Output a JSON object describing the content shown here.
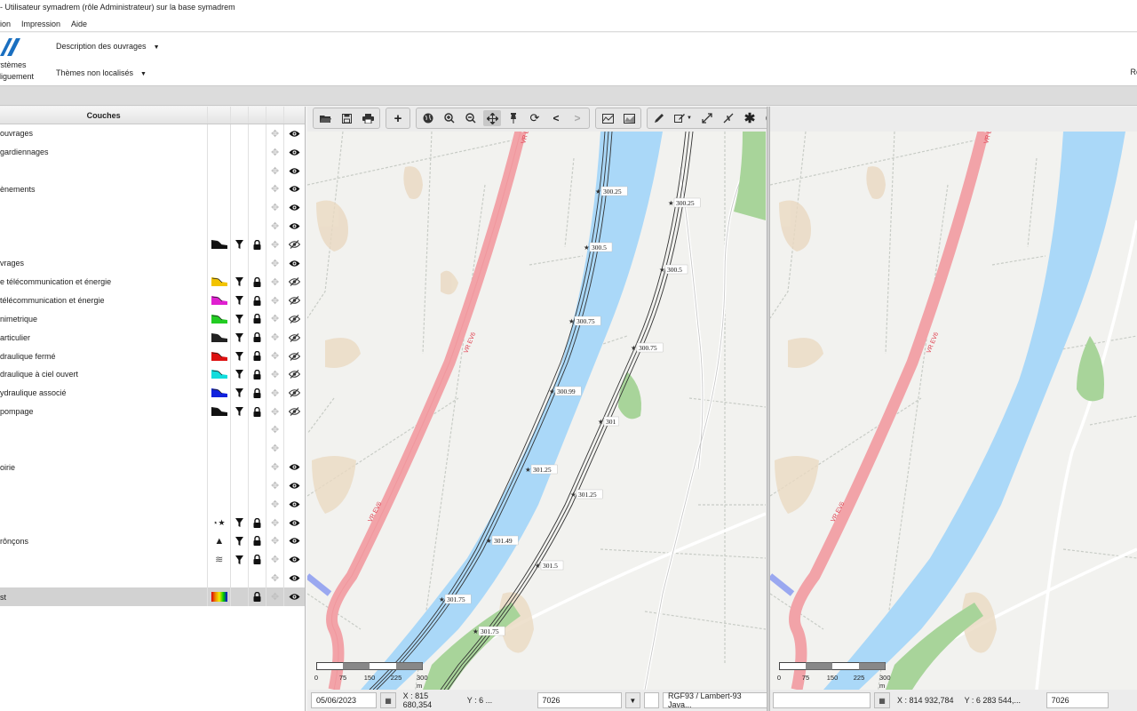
{
  "window": {
    "title": "- Utilisateur symadrem (rôle Administrateur) sur la base symadrem"
  },
  "menu": [
    "ion",
    "Impression",
    "Aide"
  ],
  "ribbon": {
    "brand_line1": "ystèmes",
    "brand_line2": "diguement",
    "description_label": "Description des ouvrages",
    "themes_label": "Thèmes non localisés",
    "right_label": "Re"
  },
  "layers": {
    "header": "Couches",
    "rows": [
      {
        "label": "ouvrages",
        "swatch": "",
        "filter": false,
        "lock": false,
        "eye": "open"
      },
      {
        "label": "gardiennages",
        "swatch": "",
        "filter": false,
        "lock": false,
        "eye": "open"
      },
      {
        "label": "",
        "swatch": "",
        "filter": false,
        "lock": false,
        "eye": "open"
      },
      {
        "label": "ènements",
        "swatch": "",
        "filter": false,
        "lock": false,
        "eye": "open"
      },
      {
        "label": "",
        "swatch": "",
        "filter": false,
        "lock": false,
        "eye": "open"
      },
      {
        "label": "",
        "swatch": "",
        "filter": false,
        "lock": false,
        "eye": "open"
      },
      {
        "label": "",
        "swatch": "#111111",
        "filter": true,
        "lock": true,
        "eye": "hidden"
      },
      {
        "label": "vrages",
        "swatch": "",
        "filter": false,
        "lock": false,
        "eye": "open"
      },
      {
        "label": "e télécommunication et énergie",
        "swatch": "#f2c300",
        "filter": true,
        "lock": true,
        "eye": "hidden"
      },
      {
        "label": "télécommunication et énergie",
        "swatch": "#e020d0",
        "filter": true,
        "lock": true,
        "eye": "hidden"
      },
      {
        "label": "nimetrique",
        "swatch": "#22cc22",
        "filter": true,
        "lock": true,
        "eye": "hidden"
      },
      {
        "label": "articulier",
        "swatch": "#222222",
        "filter": true,
        "lock": true,
        "eye": "hidden"
      },
      {
        "label": "draulique fermé",
        "swatch": "#dd1111",
        "filter": true,
        "lock": true,
        "eye": "hidden"
      },
      {
        "label": "draulique à ciel ouvert",
        "swatch": "#11dddd",
        "filter": true,
        "lock": true,
        "eye": "hidden"
      },
      {
        "label": "ydraulique associé",
        "swatch": "#1122dd",
        "filter": true,
        "lock": true,
        "eye": "hidden"
      },
      {
        "label": "pompage",
        "swatch": "#111111",
        "filter": true,
        "lock": true,
        "eye": "hidden"
      },
      {
        "label": "",
        "swatch": "",
        "filter": false,
        "lock": false,
        "eye": "none"
      },
      {
        "label": "",
        "swatch": "",
        "filter": false,
        "lock": false,
        "eye": "none"
      },
      {
        "label": "oirie",
        "swatch": "",
        "filter": false,
        "lock": false,
        "eye": "open"
      },
      {
        "label": "",
        "swatch": "",
        "filter": false,
        "lock": false,
        "eye": "open"
      },
      {
        "label": "",
        "swatch": "",
        "filter": false,
        "lock": false,
        "eye": "open"
      },
      {
        "label": "",
        "swatch": "star",
        "filter": true,
        "lock": true,
        "eye": "open"
      },
      {
        "label": "rônçons",
        "swatch": "triangle",
        "filter": true,
        "lock": true,
        "eye": "open"
      },
      {
        "label": "",
        "swatch": "waves",
        "filter": true,
        "lock": true,
        "eye": "open"
      },
      {
        "label": "",
        "swatch": "",
        "filter": false,
        "lock": false,
        "eye": "open"
      },
      {
        "label": "st",
        "swatch": "gradient",
        "filter": false,
        "lock": true,
        "eye": "open",
        "selected": true
      }
    ]
  },
  "toolbar_icons": {
    "file": [
      "open-folder-icon",
      "save-icon",
      "print-icon"
    ],
    "add": [
      "plus-icon"
    ],
    "nav": [
      "globe-icon",
      "zoom-in-icon",
      "zoom-out-icon",
      "pan-icon",
      "pin-icon",
      "refresh-icon",
      "back-icon",
      "forward-icon"
    ],
    "profile": [
      "profile-line-icon",
      "profile-area-icon"
    ],
    "edit": [
      "pencil-icon",
      "edit-menu-icon",
      "expand-icon",
      "shrink-icon",
      "asterisk-icon",
      "target-icon",
      "copy-icon",
      "export-icon",
      "info-icon"
    ]
  },
  "map_left": {
    "pk_left_bank": [
      "300.25",
      "300.5",
      "300.75",
      "300.99",
      "301.25",
      "301.49",
      "301.75"
    ],
    "pk_right_bank": [
      "300.25",
      "300.5",
      "300.75",
      "301",
      "301.25",
      "301.5",
      "301.75"
    ],
    "road_label": "VR EV6",
    "scale_labels": [
      "0",
      "75",
      "150",
      "225",
      "300 m"
    ]
  },
  "map_right": {
    "road_label": "VR EV6",
    "scale_labels": [
      "0",
      "75",
      "150",
      "225",
      "300 m"
    ]
  },
  "status_left": {
    "date": "05/06/2023",
    "coords_x": "X : 815 680,354",
    "coords_y": "Y : 6 ...",
    "epsg": "7026",
    "crs": "RGF93 / Lambert-93 Java..."
  },
  "status_right": {
    "date": "",
    "coords_x": "X : 814 932,784",
    "coords_y": "Y : 6 283 544,...",
    "epsg": "7026"
  },
  "colors": {
    "river": "#aad8f8",
    "road": "#f2a3a8",
    "levee": "#333333",
    "vegetation": "#a8d49a",
    "background": "#f2f2ef"
  }
}
